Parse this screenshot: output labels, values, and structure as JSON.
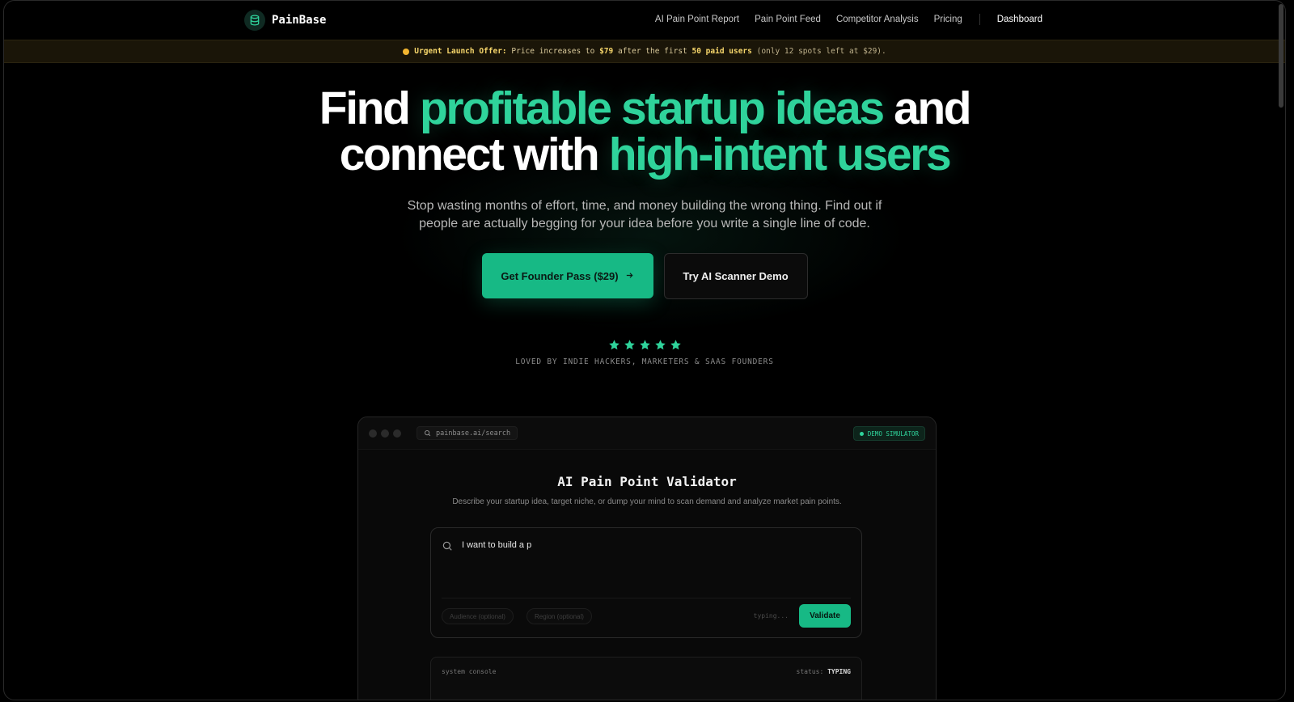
{
  "nav": {
    "brand": "PainBase",
    "links": [
      "AI Pain Point Report",
      "Pain Point Feed",
      "Competitor Analysis",
      "Pricing"
    ],
    "dashboard": "Dashboard"
  },
  "banner": {
    "label": "Urgent Launch Offer:",
    "text1": "Price increases to",
    "price": "$79",
    "text2": "after the first",
    "limit": "50 paid users",
    "tail": "(only 12 spots left at $29)."
  },
  "hero": {
    "line1_a": "Find",
    "line1_b": "profitable startup ideas",
    "line1_c": "and",
    "line2_a": "connect with",
    "line2_b": "high-intent users",
    "subtitle_1": "Stop wasting months of effort, time, and money building the wrong thing. Find out if",
    "subtitle_2": "people are actually begging for your idea before you write a single line of code.",
    "cta_primary": "Get Founder Pass ($29)",
    "cta_secondary": "Try AI Scanner Demo",
    "rating": 5,
    "loved": "LOVED BY INDIE HACKERS, MARKETERS & SAAS FOUNDERS"
  },
  "demo": {
    "url": "painbase.ai/search",
    "badge": "DEMO SIMULATOR",
    "title": "AI Pain Point Validator",
    "description": "Describe your startup idea, target niche, or dump your mind to scan demand and analyze market pain points.",
    "input_value": "I want to build a p",
    "audience_placeholder": "Audience (optional)",
    "region_placeholder": "Region (optional)",
    "typing": "typing...",
    "validate": "Validate",
    "console_label": "system console",
    "console_status_label": "status:",
    "console_status": "TYPING"
  },
  "colors": {
    "accent": "#2fd39b",
    "button": "#17b985",
    "banner_bg": "#1a1508",
    "banner_highlight": "#f6d66b"
  }
}
